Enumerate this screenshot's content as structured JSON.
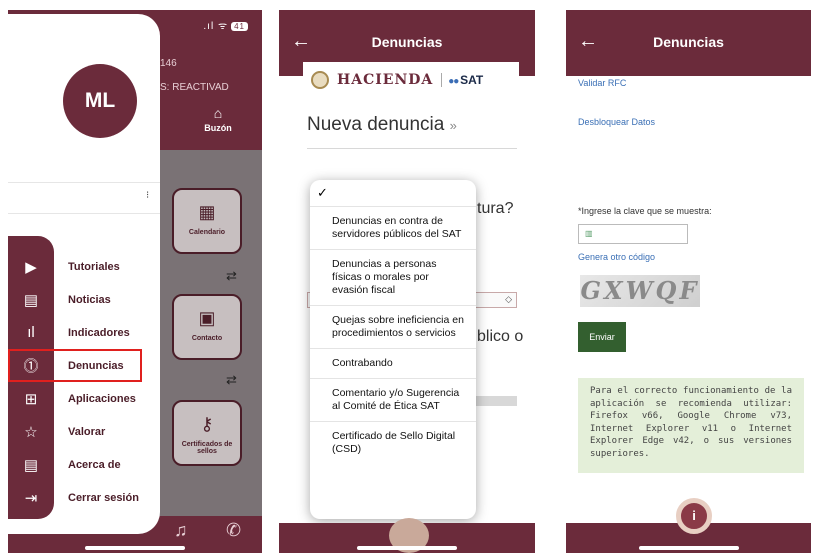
{
  "panel1": {
    "status": {
      "signal": ".ıl ᯤ",
      "battery": "41"
    },
    "bg_text_number": "146",
    "bg_text_status": "S: REACTIVAD",
    "buzon_label": "Buzón",
    "tiles": [
      {
        "label": "Calendario",
        "icon": "calendar-icon"
      },
      {
        "label": "Contacto",
        "icon": "contact-card-icon"
      },
      {
        "label": "Certificados de sellos",
        "icon": "key-icon"
      }
    ],
    "avatar_initials": "ML",
    "menu": [
      {
        "label": "Tutoriales",
        "icon": "play-icon",
        "glyph": "▶"
      },
      {
        "label": "Noticias",
        "icon": "news-icon",
        "glyph": "▤"
      },
      {
        "label": "Indicadores",
        "icon": "chart-icon",
        "glyph": "ıl"
      },
      {
        "label": "Denuncias",
        "icon": "alert-icon",
        "glyph": "⓵"
      },
      {
        "label": "Aplicaciones",
        "icon": "apps-icon",
        "glyph": "⊞"
      },
      {
        "label": "Valorar",
        "icon": "star-icon",
        "glyph": "☆"
      },
      {
        "label": "Acerca de",
        "icon": "document-icon",
        "glyph": "▤"
      },
      {
        "label": "Cerrar sesión",
        "icon": "logout-icon",
        "glyph": "⇥"
      }
    ]
  },
  "panel2": {
    "header_title": "Denuncias",
    "hacienda": "HACIENDA",
    "sat": "SAT",
    "nueva_denuncia": "Nueva denuncia",
    "ghost_text_1": "tura?",
    "ghost_text_2": "blico o",
    "picker_check": "✓",
    "picker_options": [
      "Denuncias en contra de servidores públicos del SAT",
      "Denuncias a personas físicas o morales por evasión fiscal",
      "Quejas sobre ineficiencia en procedimientos o servicios",
      "Contrabando",
      "Comentario y/o Sugerencia al Comité de Ética SAT",
      "Certificado de Sello Digital (CSD)"
    ]
  },
  "panel3": {
    "header_title": "Denuncias",
    "validar_rfc": "Validar RFC",
    "desbloquear": "Desbloquear Datos",
    "captcha_label": "*Ingrese la clave que se muestra:",
    "genera_otro": "Genera otro código",
    "captcha_text": "GXWQF",
    "enviar": "Enviar",
    "notice": "Para el correcto funcionamiento de la aplicación se recomienda utilizar: Firefox v66, Google Chrome v73, Internet Explorer v11 o Internet Explorer Edge v42, o sus versiones superiores.",
    "info_icon": "i"
  }
}
